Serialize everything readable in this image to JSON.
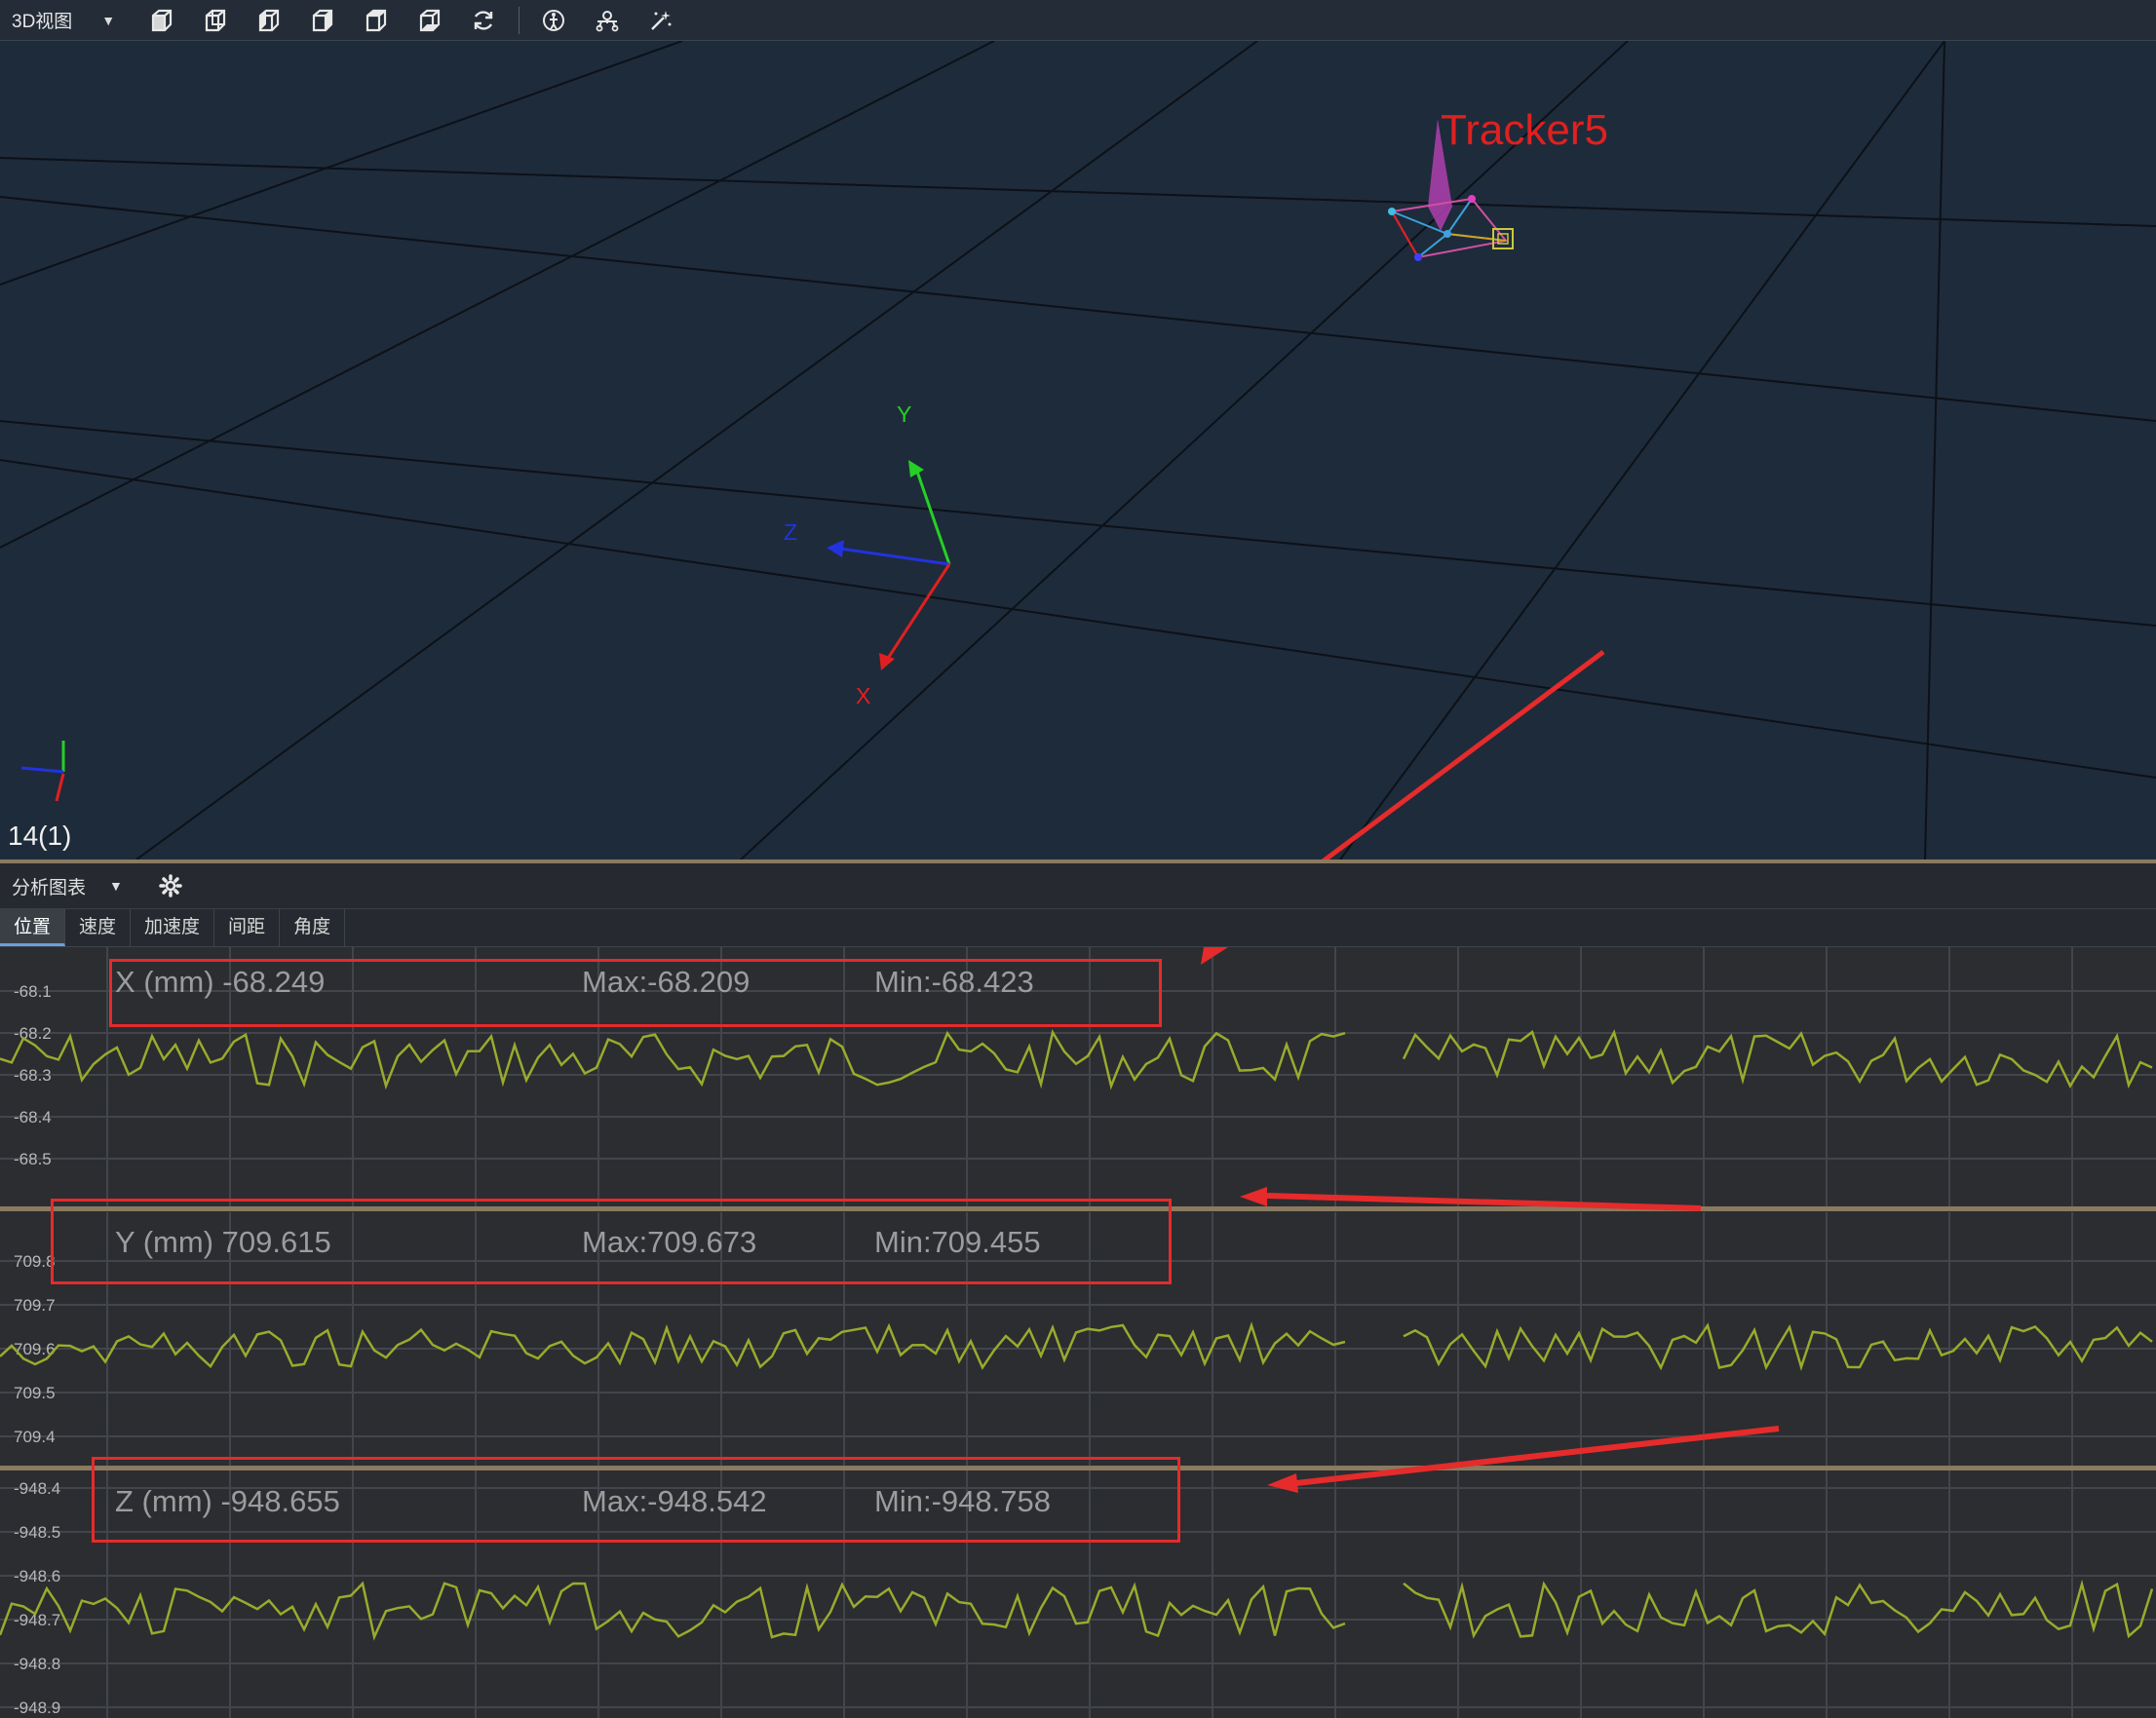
{
  "toolbar": {
    "view_label": "3D视图",
    "icons": [
      "cube-front-icon",
      "cube-back-icon",
      "cube-left-icon",
      "cube-right-icon",
      "cube-top-icon",
      "cube-bottom-icon",
      "reset-view-icon",
      "skeleton-icon",
      "drone-icon",
      "magic-wand-icon"
    ]
  },
  "viewport": {
    "tracker_label": "Tracker5",
    "axis_x": "X",
    "axis_y": "Y",
    "axis_z": "Z",
    "frame_counter": "14(1)"
  },
  "analysis": {
    "title": "分析图表",
    "tabs": [
      "位置",
      "速度",
      "加速度",
      "间距",
      "角度"
    ],
    "active_tab": 0
  },
  "charts": [
    {
      "axis": "X",
      "label": "X (mm) -68.249",
      "max": "Max:-68.209",
      "min": "Min:-68.423",
      "ticks": [
        "-68.1",
        "-68.2",
        "-68.3",
        "-68.4",
        "-68.5"
      ]
    },
    {
      "axis": "Y",
      "label": "Y (mm) 709.615",
      "max": "Max:709.673",
      "min": "Min:709.455",
      "ticks": [
        "709.8",
        "709.7",
        "709.6",
        "709.5",
        "709.4"
      ]
    },
    {
      "axis": "Z",
      "label": "Z (mm) -948.655",
      "max": "Max:-948.542",
      "min": "Min:-948.758",
      "ticks": [
        "-948.4",
        "-948.5",
        "-948.6",
        "-948.7",
        "-948.8",
        "-948.9"
      ]
    }
  ],
  "colors": {
    "grid_bg": "#1e2b3a",
    "chart_bg": "#2b2d31",
    "signal": "#9aaa2c",
    "highlight": "#e52b2b",
    "tracker_text": "#e02020"
  }
}
